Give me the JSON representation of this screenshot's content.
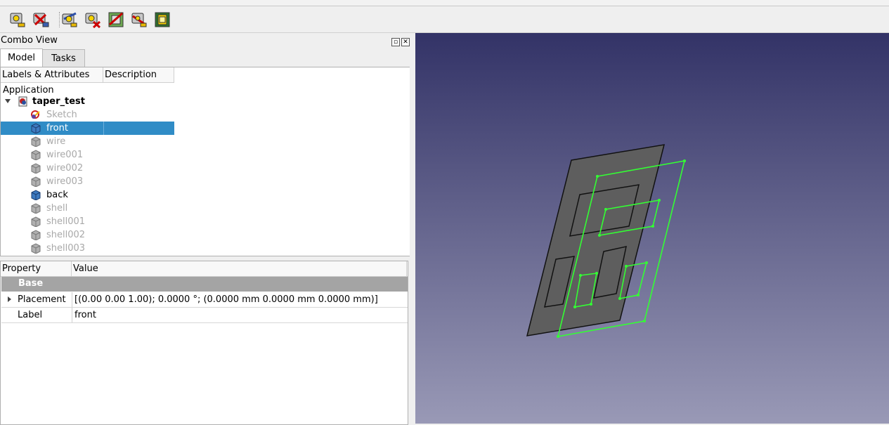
{
  "combo_view": {
    "title": "Combo View"
  },
  "tabs": [
    {
      "label": "Model"
    },
    {
      "label": "Tasks"
    }
  ],
  "tree": {
    "headers": [
      "Labels & Attributes",
      "Description"
    ],
    "root": "Application",
    "document": "taper_test",
    "items": [
      {
        "label": "Sketch",
        "icon": "sketch-icon",
        "state": "hidden"
      },
      {
        "label": "front",
        "icon": "part-box-icon",
        "state": "selected"
      },
      {
        "label": "wire",
        "icon": "part-box-icon",
        "state": "hidden"
      },
      {
        "label": "wire001",
        "icon": "part-box-icon",
        "state": "hidden"
      },
      {
        "label": "wire002",
        "icon": "part-box-icon",
        "state": "hidden"
      },
      {
        "label": "wire003",
        "icon": "part-box-icon",
        "state": "hidden"
      },
      {
        "label": "back",
        "icon": "part-box-icon",
        "state": "visible"
      },
      {
        "label": "shell",
        "icon": "part-box-icon",
        "state": "hidden"
      },
      {
        "label": "shell001",
        "icon": "part-box-icon",
        "state": "hidden"
      },
      {
        "label": "shell002",
        "icon": "part-box-icon",
        "state": "hidden"
      },
      {
        "label": "shell003",
        "icon": "part-box-icon",
        "state": "hidden"
      }
    ]
  },
  "property_view": {
    "headers": [
      "Property",
      "Value"
    ],
    "group": "Base",
    "rows": [
      {
        "property": "Placement",
        "value": "[(0.00 0.00 1.00); 0.0000 °; (0.0000 mm  0.0000 mm  0.0000 mm)]"
      },
      {
        "property": "Label",
        "value": "front"
      }
    ]
  },
  "toolbar": {
    "icons": [
      "measure-linear-icon",
      "measure-clear-icon",
      "measure-angular-icon",
      "measure-delete-icon",
      "measure-toggle-all-icon",
      "measure-toggle-3d-icon",
      "measure-toggle-delta-icon"
    ]
  },
  "colors": {
    "selection": "#308cc6",
    "wireframe": "#33ff33",
    "face": "#5e5e5e",
    "background_top": "#333367",
    "background_bottom": "#9999b6"
  }
}
